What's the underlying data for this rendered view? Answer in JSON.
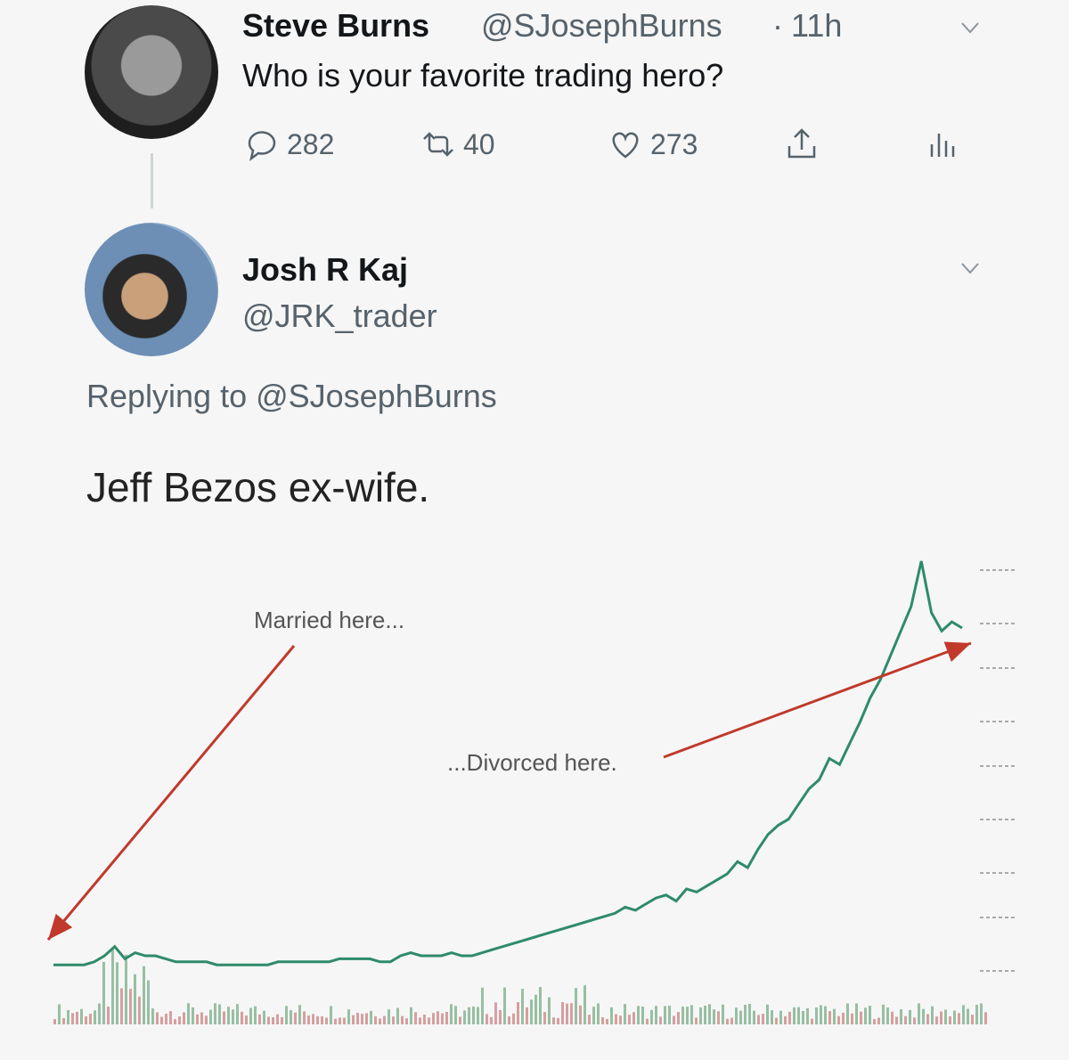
{
  "tweet": {
    "author_name": "Steve Burns",
    "author_handle": "@SJosephBurns",
    "time": "11h",
    "text": "Who is your favorite trading hero?",
    "actions": {
      "replies": "282",
      "retweets": "40",
      "likes": "273"
    }
  },
  "reply": {
    "author_name": "Josh R Kaj",
    "author_handle": "@JRK_trader",
    "replying_prefix": "Replying to",
    "replying_handle": "@SJosephBurns",
    "text": "Jeff Bezos ex-wife."
  },
  "chart_data": {
    "type": "line",
    "annotations": [
      {
        "text": "Married here...",
        "color": "#b23b3b"
      },
      {
        "text": "...Divorced here.",
        "color": "#b23b3b"
      }
    ],
    "series": [
      {
        "color": "#2e8b6a",
        "values": [
          2,
          2,
          2,
          2,
          3,
          5,
          8,
          4,
          6,
          5,
          5,
          4,
          3,
          3,
          3,
          3,
          2,
          2,
          2,
          2,
          2,
          2,
          3,
          3,
          3,
          3,
          3,
          3,
          4,
          4,
          4,
          4,
          3,
          3,
          5,
          6,
          5,
          5,
          5,
          6,
          5,
          5,
          6,
          7,
          8,
          9,
          10,
          11,
          12,
          13,
          14,
          15,
          16,
          17,
          18,
          19,
          21,
          20,
          22,
          24,
          25,
          23,
          27,
          26,
          28,
          30,
          32,
          36,
          34,
          40,
          45,
          48,
          50,
          55,
          60,
          63,
          70,
          68,
          75,
          82,
          90,
          96,
          104,
          112,
          120,
          135,
          118,
          112,
          115,
          113
        ]
      }
    ],
    "colors": {
      "line": "#2e8b6a",
      "arrow": "#c0392b",
      "volume_up": "#6fa87f",
      "volume_down": "#c97a7a"
    }
  }
}
